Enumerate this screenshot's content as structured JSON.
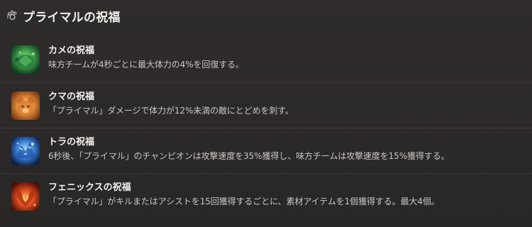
{
  "header": {
    "icon": "paw-swirl-icon",
    "title": "プライマルの祝福"
  },
  "colors": {
    "background": "#2a2828",
    "divider": "#3b3837",
    "title_text": "#f2efec",
    "desc_text": "#c9c5c1",
    "turtle_accent": "#3fa34d",
    "bear_accent": "#e08a3a",
    "tiger_accent": "#3a7fd6",
    "phoenix_accent": "#d9491f"
  },
  "blessings": [
    {
      "icon": "turtle-blessing-icon",
      "title": "カメの祝福",
      "description": "味方チームが4秒ごとに最大体力の4%を回復する。"
    },
    {
      "icon": "bear-blessing-icon",
      "title": "クマの祝福",
      "description": "「プライマル」ダメージで体力が12%未満の敵にとどめを刺す。"
    },
    {
      "icon": "tiger-blessing-icon",
      "title": "トラの祝福",
      "description": "6秒後、「プライマル」のチャンピオンは攻撃速度を35%獲得し、味方チームは攻撃速度を15%獲得する。"
    },
    {
      "icon": "phoenix-blessing-icon",
      "title": "フェニックスの祝福",
      "description": "「プライマル」がキルまたはアシストを15回獲得するごとに、素材アイテムを1個獲得する。最大4個。"
    }
  ]
}
